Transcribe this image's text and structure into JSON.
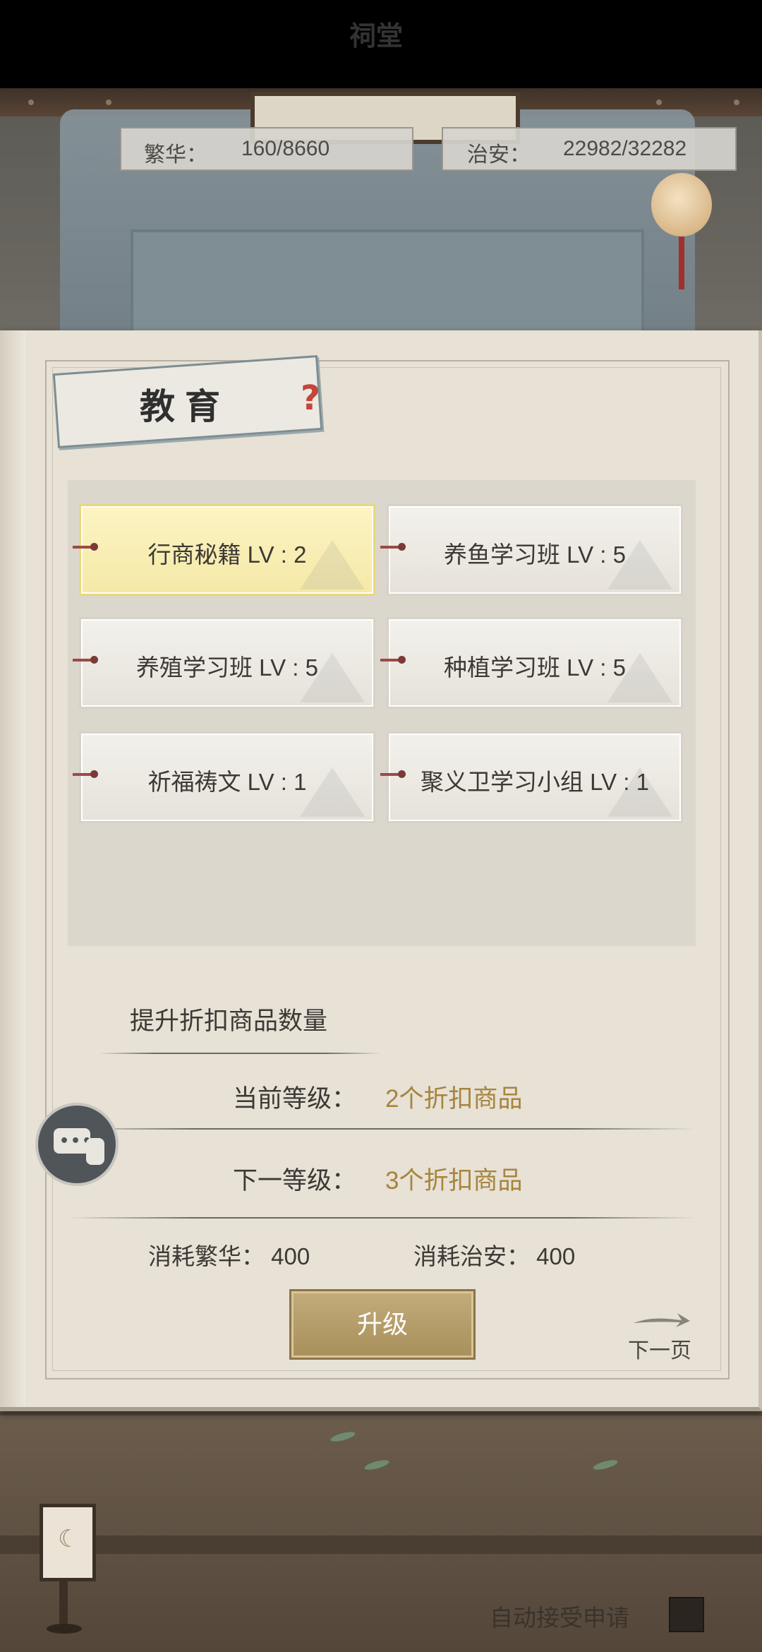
{
  "header": {
    "hall_sign": "祠堂",
    "prosperity_label": "繁华：",
    "prosperity_value": "160/8660",
    "security_label": "治安：",
    "security_value": "22982/32282"
  },
  "panel": {
    "title": "教育",
    "help_icon": "?",
    "items": [
      {
        "label": "行商秘籍 LV : 2",
        "selected": true
      },
      {
        "label": "养鱼学习班 LV : 5",
        "selected": false
      },
      {
        "label": "养殖学习班 LV : 5",
        "selected": false
      },
      {
        "label": "种植学习班 LV : 5",
        "selected": false
      },
      {
        "label": "祈福祷文 LV : 1",
        "selected": false
      },
      {
        "label": "聚义卫学习小组 LV : 1",
        "selected": false
      }
    ],
    "description": "提升折扣商品数量",
    "current_level_label": "当前等级：",
    "current_level_value": "2个折扣商品",
    "next_level_label": "下一等级：",
    "next_level_value": "3个折扣商品",
    "cost_prosperity": "消耗繁华：  400",
    "cost_security": "消耗治安：  400",
    "upgrade_button": "升级",
    "next_page": "下一页"
  },
  "footer": {
    "auto_accept": "自动接受申请"
  },
  "colors": {
    "highlight_value": "#a8843c",
    "selected_card": "#f5e9a7",
    "button_gold": "#b39c6a"
  },
  "icons": [
    "help-icon",
    "chat-icon",
    "next-arrow-icon",
    "lantern-icon",
    "checkbox-icon"
  ]
}
